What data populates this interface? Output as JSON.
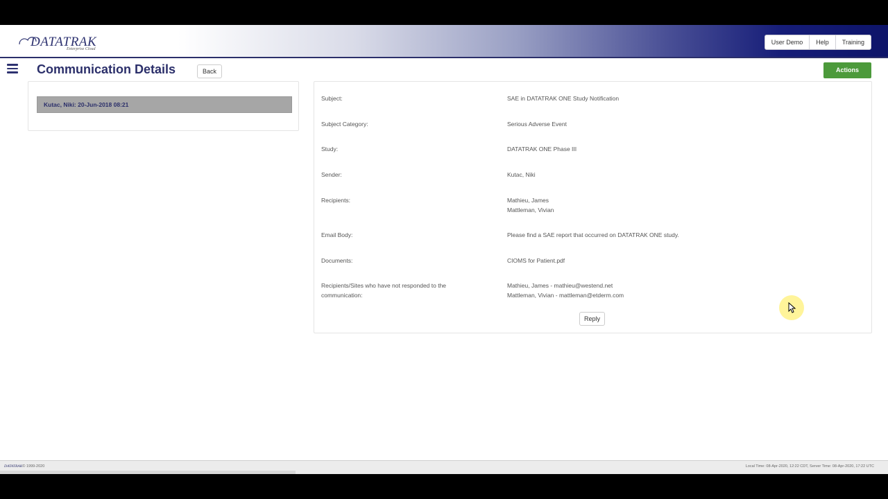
{
  "app": {
    "logo_text": "DATATRAK",
    "logo_sub": "Enterprise Cloud"
  },
  "header": {
    "buttons": [
      "User Demo",
      "Help",
      "Training"
    ]
  },
  "page": {
    "title": "Communication Details",
    "back_label": "Back",
    "actions_label": "Actions"
  },
  "communications": [
    {
      "label": "Kutac, Niki: 20-Jun-2018 08:21"
    }
  ],
  "details": {
    "subject_label": "Subject:",
    "subject": "SAE in DATATRAK ONE Study Notification",
    "category_label": "Subject Category:",
    "category": "Serious Adverse Event",
    "study_label": "Study:",
    "study": "DATATRAK ONE Phase III",
    "sender_label": "Sender:",
    "sender": "Kutac, Niki",
    "recipients_label": "Recipients:",
    "recipients": [
      "Mathieu, James",
      "Mattleman, Vivian"
    ],
    "body_label": "Email Body:",
    "body": "Please find a SAE report that occurred on DATATRAK ONE study.",
    "documents_label": "Documents:",
    "document": "CIOMS for Patient.pdf",
    "not_responded_label": "Recipients/Sites who have not responded to the communication:",
    "not_responded": [
      "Mathieu, James - mathieu@westend.net",
      "Mattleman, Vivian - mattleman@etderm.com"
    ],
    "reply_label": "Reply"
  },
  "footer": {
    "copyright_brand": "DATATRAK",
    "copyright": "© 1999-2020",
    "time_info": "Local Time: 08-Apr-2020, 12:22 CDT, Server Time: 08-Apr-2020, 17:22 UTC"
  },
  "colors": {
    "brand_navy": "#2b2f6a",
    "actions_green": "#4c9a3b",
    "selected_item_gray": "#a6a6a6"
  }
}
